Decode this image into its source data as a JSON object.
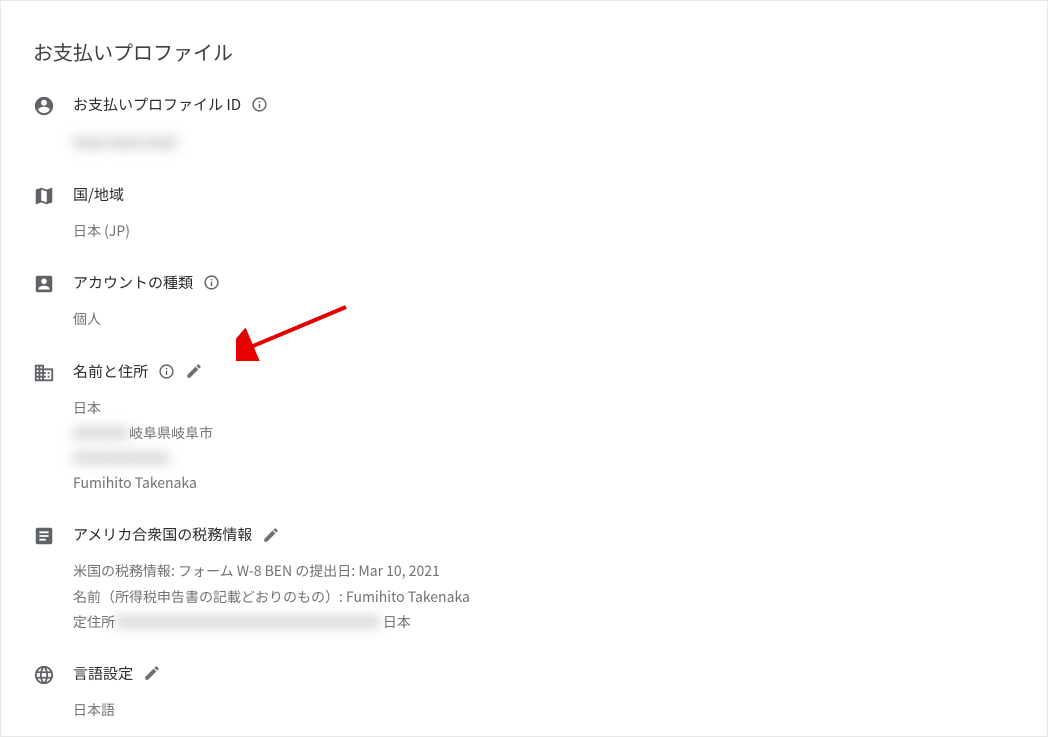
{
  "card": {
    "title": "お支払いプロファイル"
  },
  "profileId": {
    "label": "お支払いプロファイル ID",
    "value": "XXXX-XXXX-XXXX"
  },
  "country": {
    "label": "国/地域",
    "value": "日本 (JP)"
  },
  "accountType": {
    "label": "アカウントの種類",
    "value": "個人"
  },
  "nameAddress": {
    "label": "名前と住所",
    "line1": "日本",
    "line2_hidden": "XXXXXXX ",
    "line2_visible": "岐阜県岐阜市",
    "line3_hidden": "XXXXXXXXXXXX",
    "line4": "Fumihito Takenaka"
  },
  "tax": {
    "label": "アメリカ合衆国の税務情報",
    "line1": "米国の税務情報: フォーム W-8 BEN の提出日: Mar 10, 2021",
    "line2": "名前（所得税申告書の記載どおりのもの）: Fumihito Takenaka",
    "line3_prefix": "定住所",
    "line3_hidden": "XXXXXXXXXXXXXXXXXXXXXXXXXXXXXXXXX",
    "line3_suffix": " 日本"
  },
  "language": {
    "label": "言語設定",
    "value": "日本語"
  }
}
